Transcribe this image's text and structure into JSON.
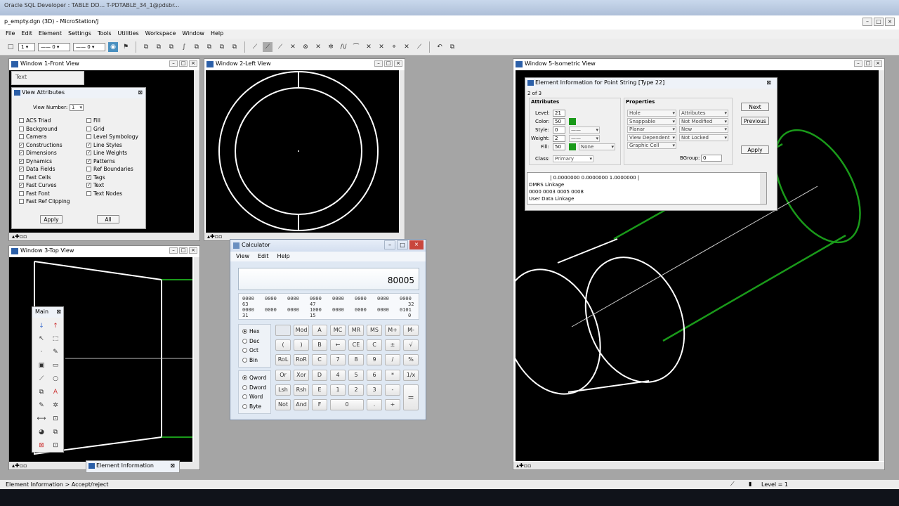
{
  "oracle_title": "Oracle SQL Developer : TABLE DD... T-PDTABLE_34_1@pdsbr...",
  "window_title": "p_empty.dgn (3D) - MicroStation/J",
  "menu": [
    "File",
    "Edit",
    "Element",
    "Settings",
    "Tools",
    "Utilities",
    "Workspace",
    "Window",
    "Help"
  ],
  "toolbar": {
    "level_value": "1",
    "style_value": "0",
    "weight_value": "0"
  },
  "views": {
    "v1": "Window 1-Front View",
    "v2": "Window 2-Left View",
    "v3": "Window 3-Top View",
    "v5": "Window 5-Isometric View"
  },
  "text_panel": "Text",
  "view_attributes": {
    "title": "View Attributes",
    "view_number_label": "View Number:",
    "view_number": "1",
    "left": [
      {
        "label": "ACS Triad",
        "checked": false
      },
      {
        "label": "Background",
        "checked": false
      },
      {
        "label": "Camera",
        "checked": false
      },
      {
        "label": "Constructions",
        "checked": true
      },
      {
        "label": "Dimensions",
        "checked": true
      },
      {
        "label": "Dynamics",
        "checked": true
      },
      {
        "label": "Data Fields",
        "checked": true
      },
      {
        "label": "Fast Cells",
        "checked": false
      },
      {
        "label": "Fast Curves",
        "checked": true
      },
      {
        "label": "Fast Font",
        "checked": false
      },
      {
        "label": "Fast Ref Clipping",
        "checked": false
      }
    ],
    "right": [
      {
        "label": "Fill",
        "checked": false
      },
      {
        "label": "Grid",
        "checked": false
      },
      {
        "label": "Level Symbology",
        "checked": false
      },
      {
        "label": "Line Styles",
        "checked": true
      },
      {
        "label": "Line Weights",
        "checked": true
      },
      {
        "label": "Patterns",
        "checked": true
      },
      {
        "label": "Ref Boundaries",
        "checked": false
      },
      {
        "label": "Tags",
        "checked": true
      },
      {
        "label": "Text",
        "checked": true
      },
      {
        "label": "Text Nodes",
        "checked": false
      }
    ],
    "apply": "Apply",
    "all": "All"
  },
  "main_palette": "Main",
  "element_info_min": "Element Information",
  "calculator": {
    "title": "Calculator",
    "menu": [
      "View",
      "Edit",
      "Help"
    ],
    "display": "80005",
    "bits_row1": [
      "0000",
      "0000",
      "0000",
      "0000",
      "0000",
      "0000",
      "0000",
      "0000"
    ],
    "bits_row1_idx": [
      "63",
      "",
      "",
      "47",
      "",
      "",
      "",
      "32"
    ],
    "bits_row2": [
      "0000",
      "0000",
      "0000",
      "1000",
      "0000",
      "0000",
      "0000",
      "0101"
    ],
    "bits_row2_idx": [
      "31",
      "",
      "",
      "15",
      "",
      "",
      "",
      "0"
    ],
    "bases": [
      {
        "label": "Hex",
        "on": true
      },
      {
        "label": "Dec",
        "on": false
      },
      {
        "label": "Oct",
        "on": false
      },
      {
        "label": "Bin",
        "on": false
      }
    ],
    "words": [
      {
        "label": "Qword",
        "on": true
      },
      {
        "label": "Dword",
        "on": false
      },
      {
        "label": "Word",
        "on": false
      },
      {
        "label": "Byte",
        "on": false
      }
    ],
    "keys": [
      [
        "",
        "Mod",
        "A",
        "MC",
        "MR",
        "MS",
        "M+",
        "M-"
      ],
      [
        "(",
        ")",
        "B",
        "←",
        "CE",
        "C",
        "±",
        "√"
      ],
      [
        "RoL",
        "RoR",
        "C",
        "7",
        "8",
        "9",
        "/",
        "%"
      ],
      [
        "Or",
        "Xor",
        "D",
        "4",
        "5",
        "6",
        "*",
        "1/x"
      ],
      [
        "Lsh",
        "Rsh",
        "E",
        "1",
        "2",
        "3",
        "-",
        ""
      ],
      [
        "Not",
        "And",
        "F",
        "0",
        "",
        ".",
        "+",
        ""
      ]
    ],
    "equals": "="
  },
  "element_info": {
    "title": "Element Information for Point String [Type 22]",
    "count": "2 of 3",
    "attributes_label": "Attributes",
    "properties_label": "Properties",
    "level_label": "Level:",
    "level": "21",
    "color_label": "Color:",
    "color": "50",
    "style_label": "Style:",
    "style": "0",
    "weight_label": "Weight:",
    "weight": "2",
    "fill_label": "Fill:",
    "fill": "50",
    "fill_mode": "None",
    "class_label": "Class:",
    "class": "Primary",
    "props_left": [
      "Hole",
      "Snappable",
      "Planar",
      "View Dependent",
      "Graphic Cell"
    ],
    "props_right": [
      "Attributes",
      "Not Modified",
      "New",
      "Not Locked"
    ],
    "bgroup_label": "BGroup:",
    "bgroup": "0",
    "next": "Next",
    "previous": "Previous",
    "apply": "Apply",
    "list": [
      "| 0.0000000  0.0000000  1.0000000 |",
      "DMRS Linkage",
      "0000  0003  0005  0008",
      "User Data Linkage"
    ],
    "green": "#1a9a1a"
  },
  "status": {
    "left": "Element Information > Accept/reject",
    "level": "Level = 1"
  }
}
